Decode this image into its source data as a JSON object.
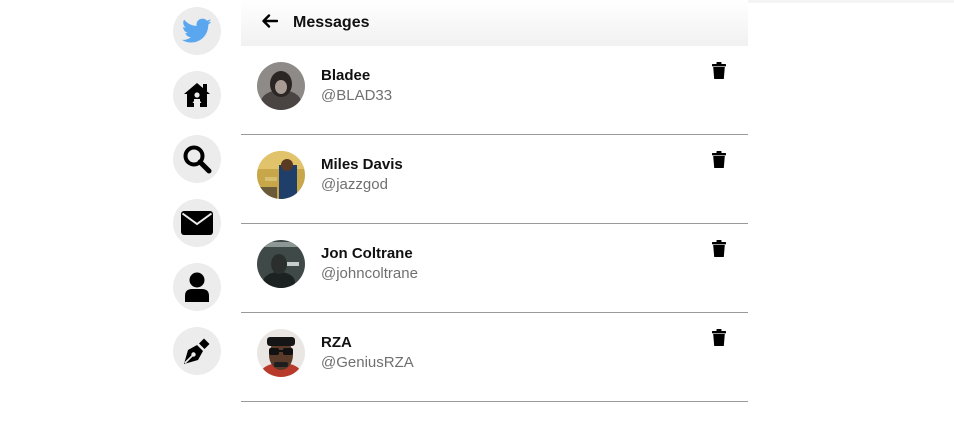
{
  "colors": {
    "twitter_blue": "#1da1f2",
    "nav_bg": "#ececec",
    "divider": "#9a9a9a",
    "handle_text": "#707070"
  },
  "sidebar": {
    "items": [
      {
        "icon": "twitter-bird-icon"
      },
      {
        "icon": "home-icon"
      },
      {
        "icon": "search-icon"
      },
      {
        "icon": "envelope-icon"
      },
      {
        "icon": "user-icon"
      },
      {
        "icon": "pen-nib-icon"
      }
    ]
  },
  "header": {
    "back_icon": "arrow-left-icon",
    "title": "Messages"
  },
  "messages": [
    {
      "name": "Bladee",
      "handle": "@BLAD33",
      "delete_icon": "trash-icon"
    },
    {
      "name": "Miles Davis",
      "handle": "@jazzgod",
      "delete_icon": "trash-icon"
    },
    {
      "name": "Jon Coltrane",
      "handle": "@johncoltrane",
      "delete_icon": "trash-icon"
    },
    {
      "name": "RZA",
      "handle": "@GeniusRZA",
      "delete_icon": "trash-icon"
    }
  ]
}
